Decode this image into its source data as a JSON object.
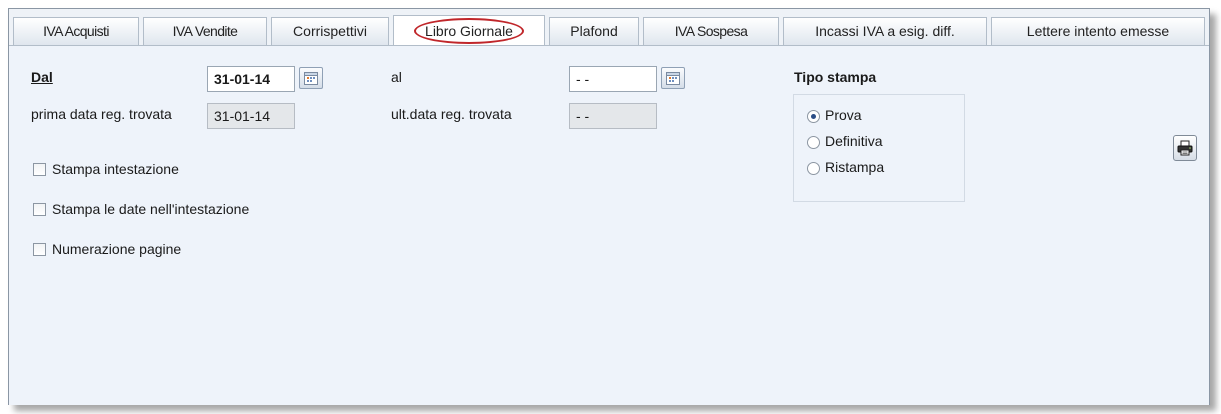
{
  "tabs": [
    {
      "label": "IVA Acquisti",
      "active": false
    },
    {
      "label": "IVA Vendite",
      "active": false
    },
    {
      "label": "Corrispettivi",
      "active": false
    },
    {
      "label": "Libro Giornale",
      "active": true
    },
    {
      "label": "Plafond",
      "active": false
    },
    {
      "label": "IVA Sospesa",
      "active": false
    },
    {
      "label": "Incassi IVA a esig. diff.",
      "active": false
    },
    {
      "label": "Lettere intento emesse",
      "active": false
    }
  ],
  "form": {
    "dal_label": "Dal",
    "dal_value": "31-01-14",
    "al_label": "al",
    "al_value": "- -",
    "prima_data_label": "prima data reg. trovata",
    "prima_data_value": "31-01-14",
    "ult_data_label": "ult.data reg. trovata",
    "ult_data_value": "- -"
  },
  "options": {
    "stampa_intestazione": {
      "label": "Stampa intestazione",
      "checked": false
    },
    "stampa_date": {
      "label": "Stampa le date nell'intestazione",
      "checked": false
    },
    "numerazione_pagine": {
      "label": "Numerazione pagine",
      "checked": false
    }
  },
  "tipo_stampa": {
    "title": "Tipo stampa",
    "options": [
      {
        "label": "Prova",
        "selected": true
      },
      {
        "label": "Definitiva",
        "selected": false
      },
      {
        "label": "Ristampa",
        "selected": false
      }
    ]
  },
  "icons": {
    "calendar": "calendar-icon",
    "print": "printer-icon"
  },
  "colors": {
    "highlight_oval": "#c0262a",
    "panel_bg": "#eef3fa"
  }
}
